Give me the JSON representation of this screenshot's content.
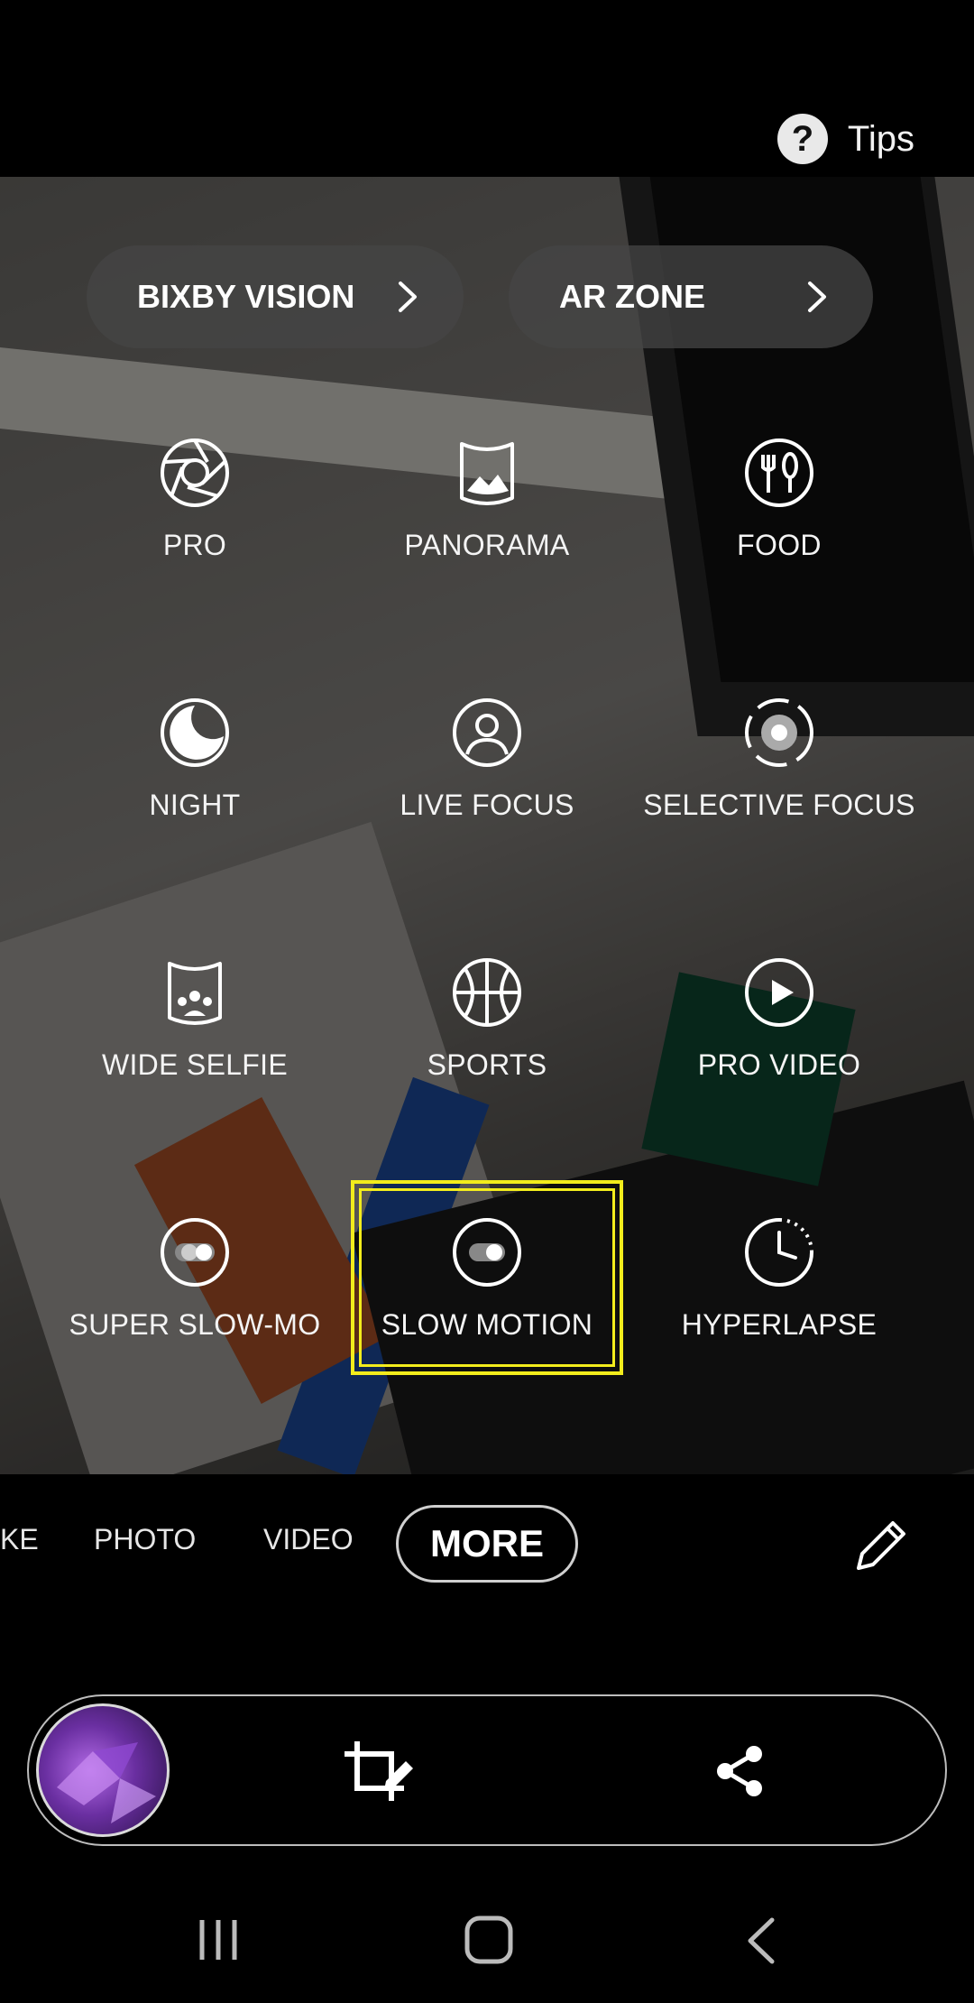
{
  "header": {
    "tips_icon_glyph": "?",
    "tips_label": "Tips"
  },
  "quick_links": [
    {
      "label": "BIXBY VISION"
    },
    {
      "label": "AR ZONE"
    }
  ],
  "modes": [
    {
      "label": "PRO",
      "icon": "aperture-icon"
    },
    {
      "label": "PANORAMA",
      "icon": "panorama-icon"
    },
    {
      "label": "FOOD",
      "icon": "fork-knife-icon"
    },
    {
      "label": "NIGHT",
      "icon": "moon-icon"
    },
    {
      "label": "LIVE FOCUS",
      "icon": "person-circle-icon"
    },
    {
      "label": "SELECTIVE FOCUS",
      "icon": "focus-ring-icon"
    },
    {
      "label": "WIDE SELFIE",
      "icon": "group-panorama-icon"
    },
    {
      "label": "SPORTS",
      "icon": "basketball-icon"
    },
    {
      "label": "PRO VIDEO",
      "icon": "play-circle-icon"
    },
    {
      "label": "SUPER SLOW-MO",
      "icon": "super-slow-toggle-icon"
    },
    {
      "label": "SLOW MOTION",
      "icon": "slow-toggle-icon"
    },
    {
      "label": "HYPERLAPSE",
      "icon": "hyperlapse-clock-icon"
    }
  ],
  "highlighted_mode": "SLOW MOTION",
  "mode_tabs": {
    "partial": "KE",
    "photo": "PHOTO",
    "video": "VIDEO",
    "more": "MORE"
  },
  "colors": {
    "highlight": "#f2ec1c",
    "background": "#000000"
  }
}
